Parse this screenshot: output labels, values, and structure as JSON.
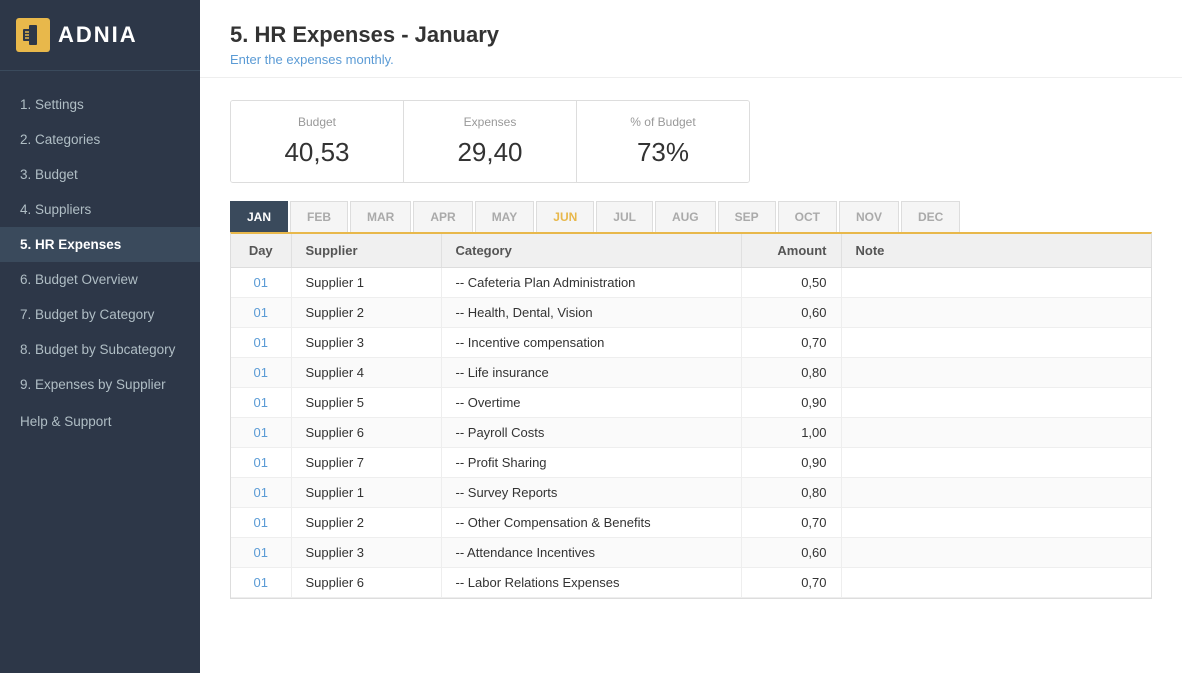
{
  "app": {
    "logo_icon": "//",
    "logo_text": "ADNIA"
  },
  "sidebar": {
    "items": [
      {
        "id": "settings",
        "label": "1. Settings",
        "active": false
      },
      {
        "id": "categories",
        "label": "2. Categories",
        "active": false
      },
      {
        "id": "budget",
        "label": "3. Budget",
        "active": false
      },
      {
        "id": "suppliers",
        "label": "4. Suppliers",
        "active": false
      },
      {
        "id": "hr-expenses",
        "label": "5. HR Expenses",
        "active": true
      },
      {
        "id": "budget-overview",
        "label": "6. Budget Overview",
        "active": false
      },
      {
        "id": "budget-by-category",
        "label": "7. Budget by Category",
        "active": false
      },
      {
        "id": "budget-by-subcategory",
        "label": "8. Budget by Subcategory",
        "active": false
      },
      {
        "id": "expenses-by-supplier",
        "label": "9. Expenses by Supplier",
        "active": false
      }
    ],
    "help_label": "Help & Support"
  },
  "page": {
    "title": "5. HR Expenses - January",
    "subtitle": "Enter the expenses monthly."
  },
  "summary": {
    "budget_label": "Budget",
    "budget_value": "40,53",
    "expenses_label": "Expenses",
    "expenses_value": "29,40",
    "pct_label": "% of Budget",
    "pct_value": "73%"
  },
  "months": [
    {
      "label": "JAN",
      "active": true
    },
    {
      "label": "FEB",
      "active": false
    },
    {
      "label": "MAR",
      "active": false
    },
    {
      "label": "APR",
      "active": false
    },
    {
      "label": "MAY",
      "active": false
    },
    {
      "label": "JUN",
      "active": false
    },
    {
      "label": "JUL",
      "active": false
    },
    {
      "label": "AUG",
      "active": false
    },
    {
      "label": "SEP",
      "active": false
    },
    {
      "label": "OCT",
      "active": false
    },
    {
      "label": "NOV",
      "active": false
    },
    {
      "label": "DEC",
      "active": false
    }
  ],
  "table": {
    "headers": [
      "Day",
      "Supplier",
      "Category",
      "Amount",
      "Note"
    ],
    "rows": [
      {
        "day": "01",
        "supplier": "Supplier 1",
        "category": "-- Cafeteria Plan Administration",
        "amount": "0,50",
        "note": ""
      },
      {
        "day": "01",
        "supplier": "Supplier 2",
        "category": "-- Health, Dental, Vision",
        "amount": "0,60",
        "note": ""
      },
      {
        "day": "01",
        "supplier": "Supplier 3",
        "category": "-- Incentive compensation",
        "amount": "0,70",
        "note": ""
      },
      {
        "day": "01",
        "supplier": "Supplier 4",
        "category": "-- Life insurance",
        "amount": "0,80",
        "note": ""
      },
      {
        "day": "01",
        "supplier": "Supplier 5",
        "category": "-- Overtime",
        "amount": "0,90",
        "note": ""
      },
      {
        "day": "01",
        "supplier": "Supplier 6",
        "category": "-- Payroll Costs",
        "amount": "1,00",
        "note": ""
      },
      {
        "day": "01",
        "supplier": "Supplier 7",
        "category": "-- Profit Sharing",
        "amount": "0,90",
        "note": ""
      },
      {
        "day": "01",
        "supplier": "Supplier 1",
        "category": "-- Survey Reports",
        "amount": "0,80",
        "note": ""
      },
      {
        "day": "01",
        "supplier": "Supplier 2",
        "category": "-- Other Compensation & Benefits",
        "amount": "0,70",
        "note": ""
      },
      {
        "day": "01",
        "supplier": "Supplier 3",
        "category": "-- Attendance Incentives",
        "amount": "0,60",
        "note": ""
      },
      {
        "day": "01",
        "supplier": "Supplier 6",
        "category": "-- Labor Relations Expenses",
        "amount": "0,70",
        "note": ""
      }
    ]
  }
}
